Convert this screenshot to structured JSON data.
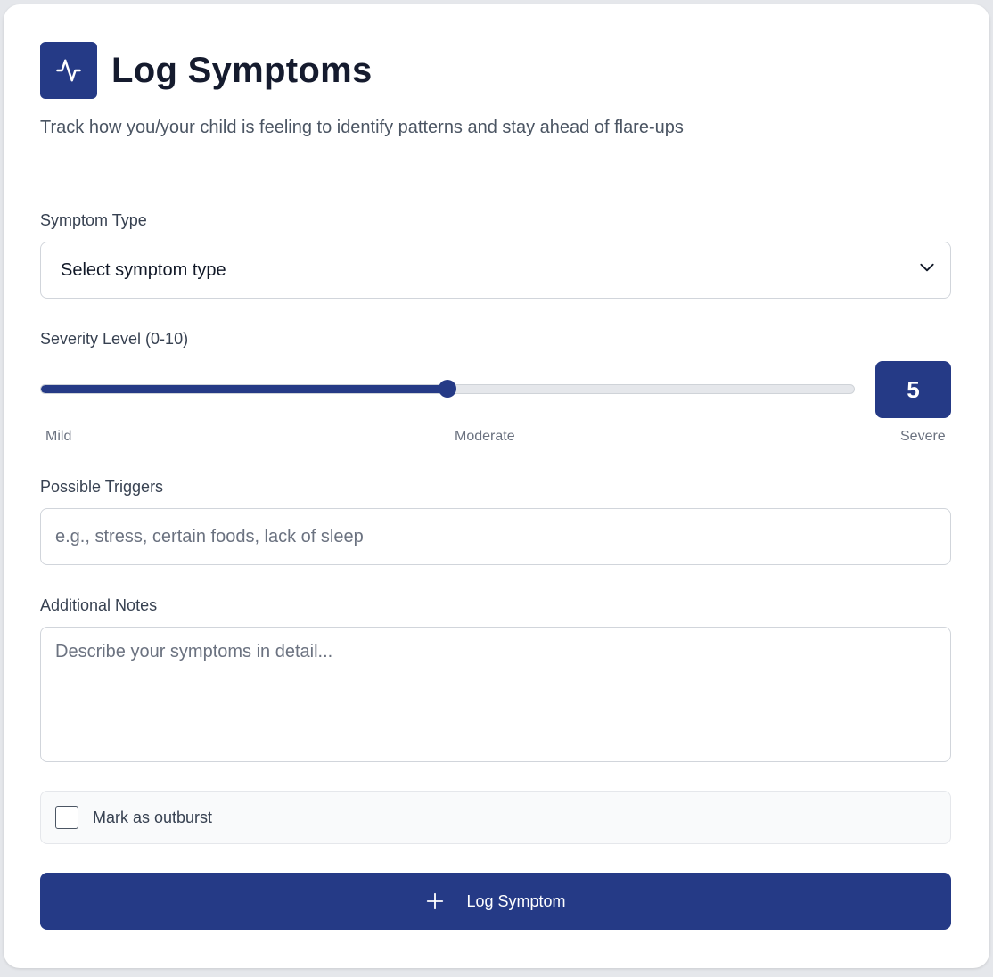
{
  "header": {
    "icon": "activity-icon",
    "title": "Log Symptoms",
    "subtitle": "Track how you/your child is feeling to identify patterns and stay ahead of flare-ups"
  },
  "symptom_type": {
    "label": "Symptom Type",
    "selected": "Select symptom type",
    "icon": "chevron-down-icon"
  },
  "severity": {
    "label": "Severity Level (0-10)",
    "value": "5",
    "min": 0,
    "max": 10,
    "scale_labels": {
      "low": "Mild",
      "mid": "Moderate",
      "high": "Severe"
    }
  },
  "triggers": {
    "label": "Possible Triggers",
    "placeholder": "e.g., stress, certain foods, lack of sleep",
    "value": ""
  },
  "notes": {
    "label": "Additional Notes",
    "placeholder": "Describe your symptoms in detail...",
    "value": ""
  },
  "outburst": {
    "label": "Mark as outburst",
    "checked": false
  },
  "submit": {
    "icon": "plus-icon",
    "label": "Log Symptom"
  },
  "colors": {
    "accent": "#253a86",
    "background": "#e5e7eb",
    "card": "#ffffff"
  }
}
